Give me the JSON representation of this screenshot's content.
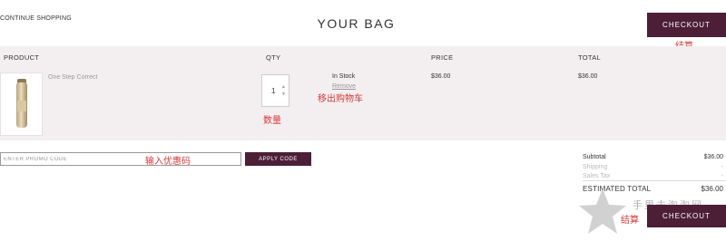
{
  "header": {
    "continue_label": "CONTINUE SHOPPING",
    "title": "YOUR BAG",
    "checkout_label": "CHECKOUT",
    "checkout_annotation": "结算"
  },
  "table": {
    "headers": [
      "PRODUCT",
      "QTY",
      "PRICE",
      "TOTAL"
    ]
  },
  "item": {
    "name": "One Step Correct",
    "quantity": "1",
    "stock_status": "In Stock",
    "remove_label": "Remove",
    "price": "$36.00",
    "total": "$36.00",
    "remove_annotation": "移出购物车",
    "qty_annotation": "数量"
  },
  "promo": {
    "placeholder": "ENTER PROMO CODE",
    "apply_label": "APPLY CODE",
    "annotation": "输入优惠码"
  },
  "summary": {
    "subtotal_label": "Subtotal",
    "subtotal_value": "$36.00",
    "shipping_label": "Shipping",
    "shipping_value": "-",
    "tax_label": "Sales Tax",
    "tax_value": "-",
    "estimated_label": "ESTIMATED TOTAL",
    "estimated_value": "$36.00",
    "checkout_label": "CHECKOUT",
    "checkout_annotation": "结算"
  },
  "watermark": {
    "text": "手里未淘淘网"
  },
  "colors": {
    "brand": "#4c1f37",
    "band_bg": "#f3eff0",
    "annotation": "#d63a3a"
  }
}
